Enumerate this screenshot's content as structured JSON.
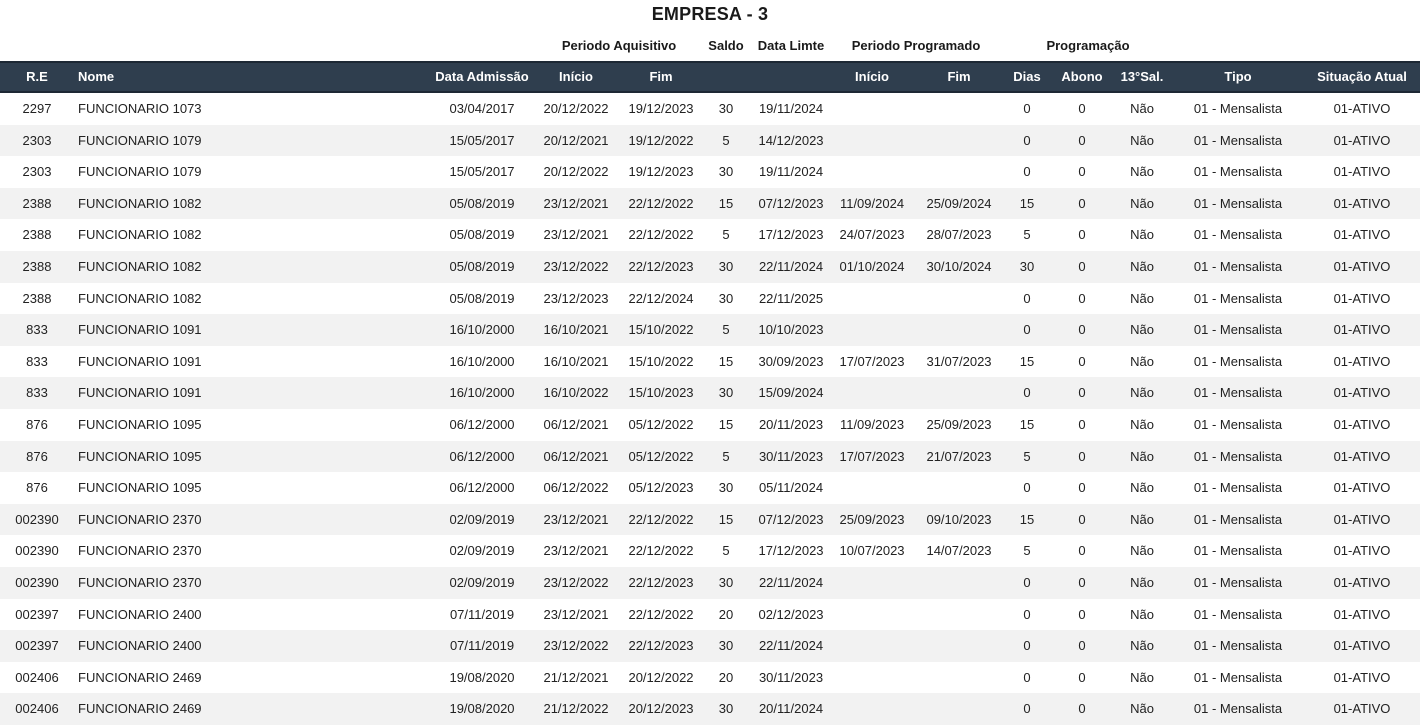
{
  "title": "EMPRESA - 3",
  "groups": {
    "periodo_aquisitivo": "Periodo Aquisitivo",
    "saldo": "Saldo",
    "data_limite": "Data Limte",
    "periodo_programado": "Periodo Programado",
    "programacao": "Programação"
  },
  "columns": {
    "re": "R.E",
    "nome": "Nome",
    "data_admissao": "Data Admissão",
    "aq_inicio": "Início",
    "aq_fim": "Fim",
    "prog_inicio": "Início",
    "prog_fim": "Fim",
    "dias": "Dias",
    "abono": "Abono",
    "decimo": "13°Sal.",
    "tipo": "Tipo",
    "situacao": "Situação Atual"
  },
  "rows": [
    {
      "re": "2297",
      "nome": "FUNCIONARIO 1073",
      "adm": "03/04/2017",
      "aq_ini": "20/12/2022",
      "aq_fim": "19/12/2023",
      "saldo": "30",
      "limite": "19/11/2024",
      "pr_ini": "",
      "pr_fim": "",
      "dias": "0",
      "abono": "0",
      "decimo": "Não",
      "tipo": "01 - Mensalista",
      "situacao": "01-ATIVO"
    },
    {
      "re": "2303",
      "nome": "FUNCIONARIO 1079",
      "adm": "15/05/2017",
      "aq_ini": "20/12/2021",
      "aq_fim": "19/12/2022",
      "saldo": "5",
      "limite": "14/12/2023",
      "pr_ini": "",
      "pr_fim": "",
      "dias": "0",
      "abono": "0",
      "decimo": "Não",
      "tipo": "01 - Mensalista",
      "situacao": "01-ATIVO"
    },
    {
      "re": "2303",
      "nome": "FUNCIONARIO 1079",
      "adm": "15/05/2017",
      "aq_ini": "20/12/2022",
      "aq_fim": "19/12/2023",
      "saldo": "30",
      "limite": "19/11/2024",
      "pr_ini": "",
      "pr_fim": "",
      "dias": "0",
      "abono": "0",
      "decimo": "Não",
      "tipo": "01 - Mensalista",
      "situacao": "01-ATIVO"
    },
    {
      "re": "2388",
      "nome": "FUNCIONARIO 1082",
      "adm": "05/08/2019",
      "aq_ini": "23/12/2021",
      "aq_fim": "22/12/2022",
      "saldo": "15",
      "limite": "07/12/2023",
      "pr_ini": "11/09/2024",
      "pr_fim": "25/09/2024",
      "dias": "15",
      "abono": "0",
      "decimo": "Não",
      "tipo": "01 - Mensalista",
      "situacao": "01-ATIVO"
    },
    {
      "re": "2388",
      "nome": "FUNCIONARIO 1082",
      "adm": "05/08/2019",
      "aq_ini": "23/12/2021",
      "aq_fim": "22/12/2022",
      "saldo": "5",
      "limite": "17/12/2023",
      "pr_ini": "24/07/2023",
      "pr_fim": "28/07/2023",
      "dias": "5",
      "abono": "0",
      "decimo": "Não",
      "tipo": "01 - Mensalista",
      "situacao": "01-ATIVO"
    },
    {
      "re": "2388",
      "nome": "FUNCIONARIO 1082",
      "adm": "05/08/2019",
      "aq_ini": "23/12/2022",
      "aq_fim": "22/12/2023",
      "saldo": "30",
      "limite": "22/11/2024",
      "pr_ini": "01/10/2024",
      "pr_fim": "30/10/2024",
      "dias": "30",
      "abono": "0",
      "decimo": "Não",
      "tipo": "01 - Mensalista",
      "situacao": "01-ATIVO"
    },
    {
      "re": "2388",
      "nome": "FUNCIONARIO 1082",
      "adm": "05/08/2019",
      "aq_ini": "23/12/2023",
      "aq_fim": "22/12/2024",
      "saldo": "30",
      "limite": "22/11/2025",
      "pr_ini": "",
      "pr_fim": "",
      "dias": "0",
      "abono": "0",
      "decimo": "Não",
      "tipo": "01 - Mensalista",
      "situacao": "01-ATIVO"
    },
    {
      "re": "833",
      "nome": "FUNCIONARIO 1091",
      "adm": "16/10/2000",
      "aq_ini": "16/10/2021",
      "aq_fim": "15/10/2022",
      "saldo": "5",
      "limite": "10/10/2023",
      "pr_ini": "",
      "pr_fim": "",
      "dias": "0",
      "abono": "0",
      "decimo": "Não",
      "tipo": "01 - Mensalista",
      "situacao": "01-ATIVO"
    },
    {
      "re": "833",
      "nome": "FUNCIONARIO 1091",
      "adm": "16/10/2000",
      "aq_ini": "16/10/2021",
      "aq_fim": "15/10/2022",
      "saldo": "15",
      "limite": "30/09/2023",
      "pr_ini": "17/07/2023",
      "pr_fim": "31/07/2023",
      "dias": "15",
      "abono": "0",
      "decimo": "Não",
      "tipo": "01 - Mensalista",
      "situacao": "01-ATIVO"
    },
    {
      "re": "833",
      "nome": "FUNCIONARIO 1091",
      "adm": "16/10/2000",
      "aq_ini": "16/10/2022",
      "aq_fim": "15/10/2023",
      "saldo": "30",
      "limite": "15/09/2024",
      "pr_ini": "",
      "pr_fim": "",
      "dias": "0",
      "abono": "0",
      "decimo": "Não",
      "tipo": "01 - Mensalista",
      "situacao": "01-ATIVO"
    },
    {
      "re": "876",
      "nome": "FUNCIONARIO 1095",
      "adm": "06/12/2000",
      "aq_ini": "06/12/2021",
      "aq_fim": "05/12/2022",
      "saldo": "15",
      "limite": "20/11/2023",
      "pr_ini": "11/09/2023",
      "pr_fim": "25/09/2023",
      "dias": "15",
      "abono": "0",
      "decimo": "Não",
      "tipo": "01 - Mensalista",
      "situacao": "01-ATIVO"
    },
    {
      "re": "876",
      "nome": "FUNCIONARIO 1095",
      "adm": "06/12/2000",
      "aq_ini": "06/12/2021",
      "aq_fim": "05/12/2022",
      "saldo": "5",
      "limite": "30/11/2023",
      "pr_ini": "17/07/2023",
      "pr_fim": "21/07/2023",
      "dias": "5",
      "abono": "0",
      "decimo": "Não",
      "tipo": "01 - Mensalista",
      "situacao": "01-ATIVO"
    },
    {
      "re": "876",
      "nome": "FUNCIONARIO 1095",
      "adm": "06/12/2000",
      "aq_ini": "06/12/2022",
      "aq_fim": "05/12/2023",
      "saldo": "30",
      "limite": "05/11/2024",
      "pr_ini": "",
      "pr_fim": "",
      "dias": "0",
      "abono": "0",
      "decimo": "Não",
      "tipo": "01 - Mensalista",
      "situacao": "01-ATIVO"
    },
    {
      "re": "002390",
      "nome": "FUNCIONARIO 2370",
      "adm": "02/09/2019",
      "aq_ini": "23/12/2021",
      "aq_fim": "22/12/2022",
      "saldo": "15",
      "limite": "07/12/2023",
      "pr_ini": "25/09/2023",
      "pr_fim": "09/10/2023",
      "dias": "15",
      "abono": "0",
      "decimo": "Não",
      "tipo": "01 - Mensalista",
      "situacao": "01-ATIVO"
    },
    {
      "re": "002390",
      "nome": "FUNCIONARIO 2370",
      "adm": "02/09/2019",
      "aq_ini": "23/12/2021",
      "aq_fim": "22/12/2022",
      "saldo": "5",
      "limite": "17/12/2023",
      "pr_ini": "10/07/2023",
      "pr_fim": "14/07/2023",
      "dias": "5",
      "abono": "0",
      "decimo": "Não",
      "tipo": "01 - Mensalista",
      "situacao": "01-ATIVO"
    },
    {
      "re": "002390",
      "nome": "FUNCIONARIO 2370",
      "adm": "02/09/2019",
      "aq_ini": "23/12/2022",
      "aq_fim": "22/12/2023",
      "saldo": "30",
      "limite": "22/11/2024",
      "pr_ini": "",
      "pr_fim": "",
      "dias": "0",
      "abono": "0",
      "decimo": "Não",
      "tipo": "01 - Mensalista",
      "situacao": "01-ATIVO"
    },
    {
      "re": "002397",
      "nome": "FUNCIONARIO 2400",
      "adm": "07/11/2019",
      "aq_ini": "23/12/2021",
      "aq_fim": "22/12/2022",
      "saldo": "20",
      "limite": "02/12/2023",
      "pr_ini": "",
      "pr_fim": "",
      "dias": "0",
      "abono": "0",
      "decimo": "Não",
      "tipo": "01 - Mensalista",
      "situacao": "01-ATIVO"
    },
    {
      "re": "002397",
      "nome": "FUNCIONARIO 2400",
      "adm": "07/11/2019",
      "aq_ini": "23/12/2022",
      "aq_fim": "22/12/2023",
      "saldo": "30",
      "limite": "22/11/2024",
      "pr_ini": "",
      "pr_fim": "",
      "dias": "0",
      "abono": "0",
      "decimo": "Não",
      "tipo": "01 - Mensalista",
      "situacao": "01-ATIVO"
    },
    {
      "re": "002406",
      "nome": "FUNCIONARIO 2469",
      "adm": "19/08/2020",
      "aq_ini": "21/12/2021",
      "aq_fim": "20/12/2022",
      "saldo": "20",
      "limite": "30/11/2023",
      "pr_ini": "",
      "pr_fim": "",
      "dias": "0",
      "abono": "0",
      "decimo": "Não",
      "tipo": "01 - Mensalista",
      "situacao": "01-ATIVO"
    },
    {
      "re": "002406",
      "nome": "FUNCIONARIO 2469",
      "adm": "19/08/2020",
      "aq_ini": "21/12/2022",
      "aq_fim": "20/12/2023",
      "saldo": "30",
      "limite": "20/11/2024",
      "pr_ini": "",
      "pr_fim": "",
      "dias": "0",
      "abono": "0",
      "decimo": "Não",
      "tipo": "01 - Mensalista",
      "situacao": "01-ATIVO"
    }
  ]
}
